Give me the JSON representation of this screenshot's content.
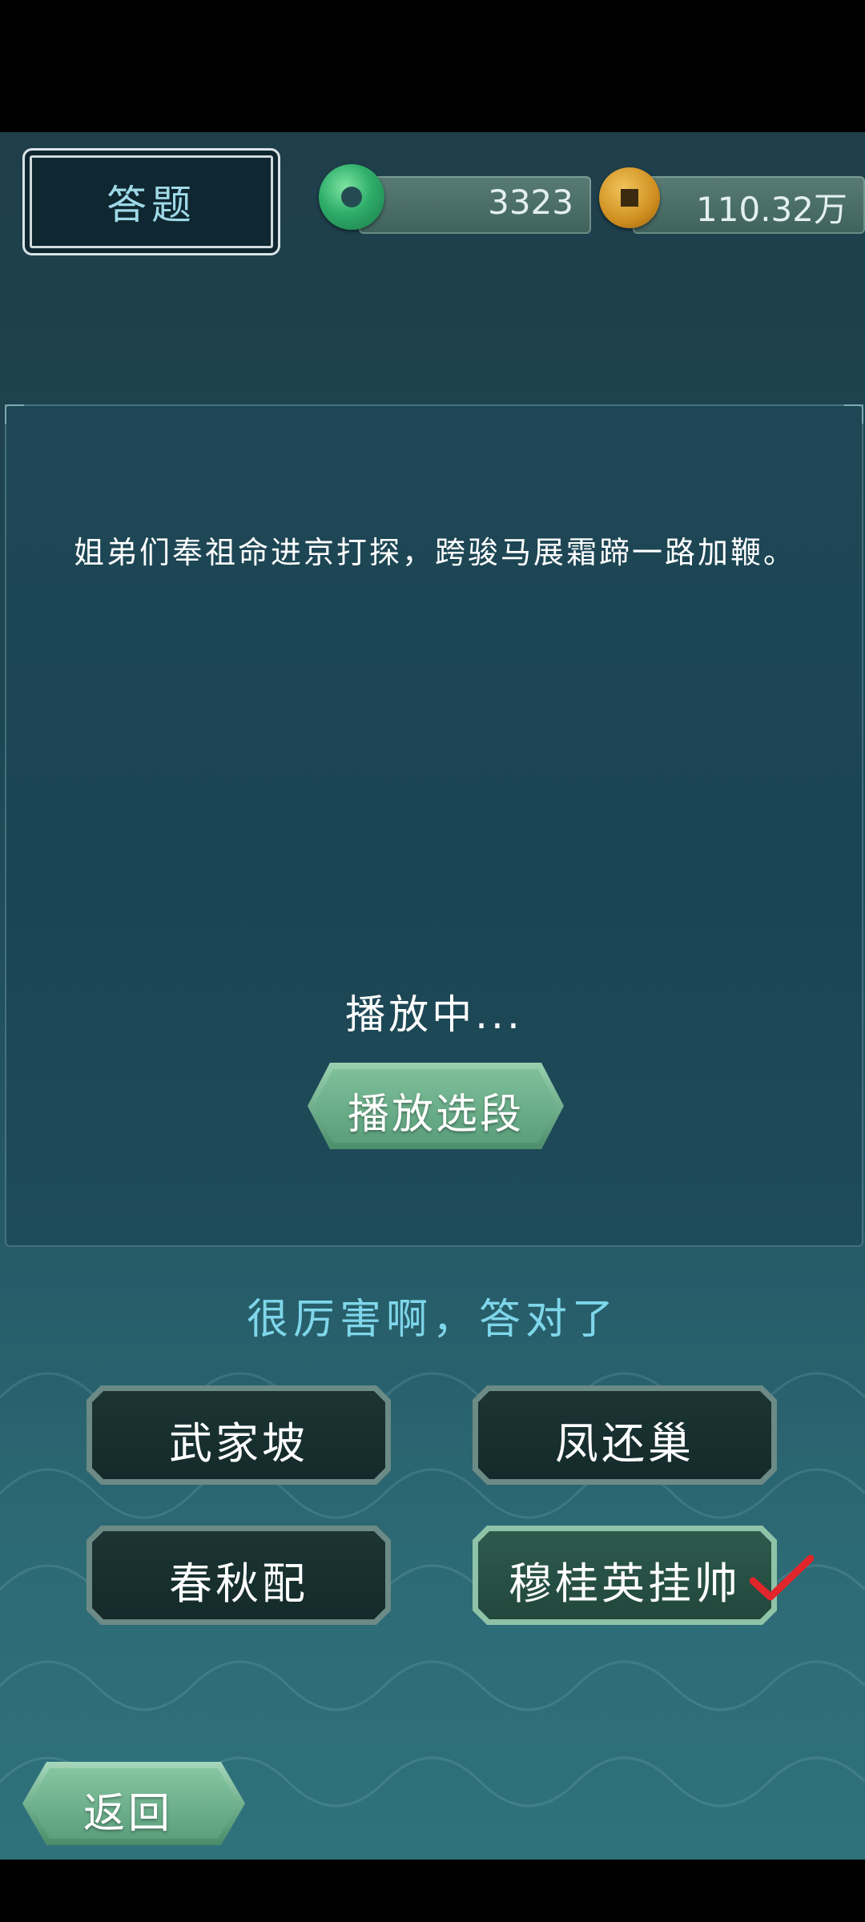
{
  "header": {
    "title": "答题",
    "jade_amount": "3323",
    "coin_amount": "110.32万"
  },
  "question": {
    "text": "姐弟们奉祖命进京打探，跨骏马展霜蹄一路加鞭。",
    "status": "播放中...",
    "play_button_label": "播放选段"
  },
  "feedback": "很厉害啊，答对了",
  "options": [
    {
      "label": "武家坡",
      "correct": false
    },
    {
      "label": "凤还巢",
      "correct": false
    },
    {
      "label": "春秋配",
      "correct": false
    },
    {
      "label": "穆桂英挂帅",
      "correct": true
    }
  ],
  "footer": {
    "back_label": "返回"
  },
  "colors": {
    "feedback": "#7fd6ea",
    "check": "#e0262b"
  }
}
